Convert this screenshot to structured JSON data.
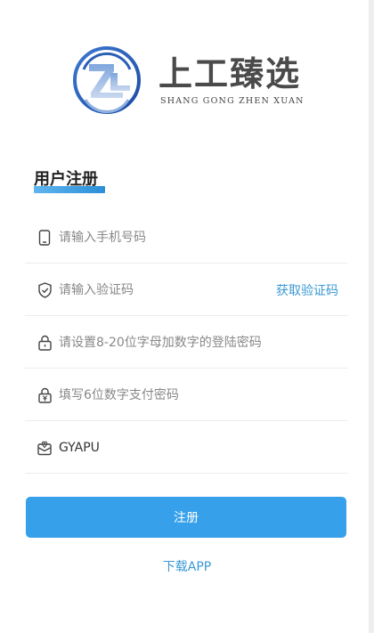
{
  "brand": {
    "name_cn": "上工臻选",
    "name_en": "SHANG GONG ZHEN XUAN",
    "colors": {
      "accent": "#36a0ea",
      "link": "#3a98d4",
      "logo_blue": "#2d63b8"
    }
  },
  "page_title": "用户注册",
  "form": {
    "phone": {
      "placeholder": "请输入手机号码",
      "icon": "phone-icon"
    },
    "code": {
      "placeholder": "请输入验证码",
      "icon": "shield-icon",
      "get_code_label": "获取验证码"
    },
    "password": {
      "placeholder": "请设置8-20位字母加数字的登陆密码",
      "icon": "lock-icon"
    },
    "pay_password": {
      "placeholder": "填写6位数字支付密码",
      "icon": "yen-lock-icon"
    },
    "invite": {
      "value": "GYAPU",
      "icon": "gift-icon"
    }
  },
  "submit_label": "注册",
  "download_label": "下载APP"
}
